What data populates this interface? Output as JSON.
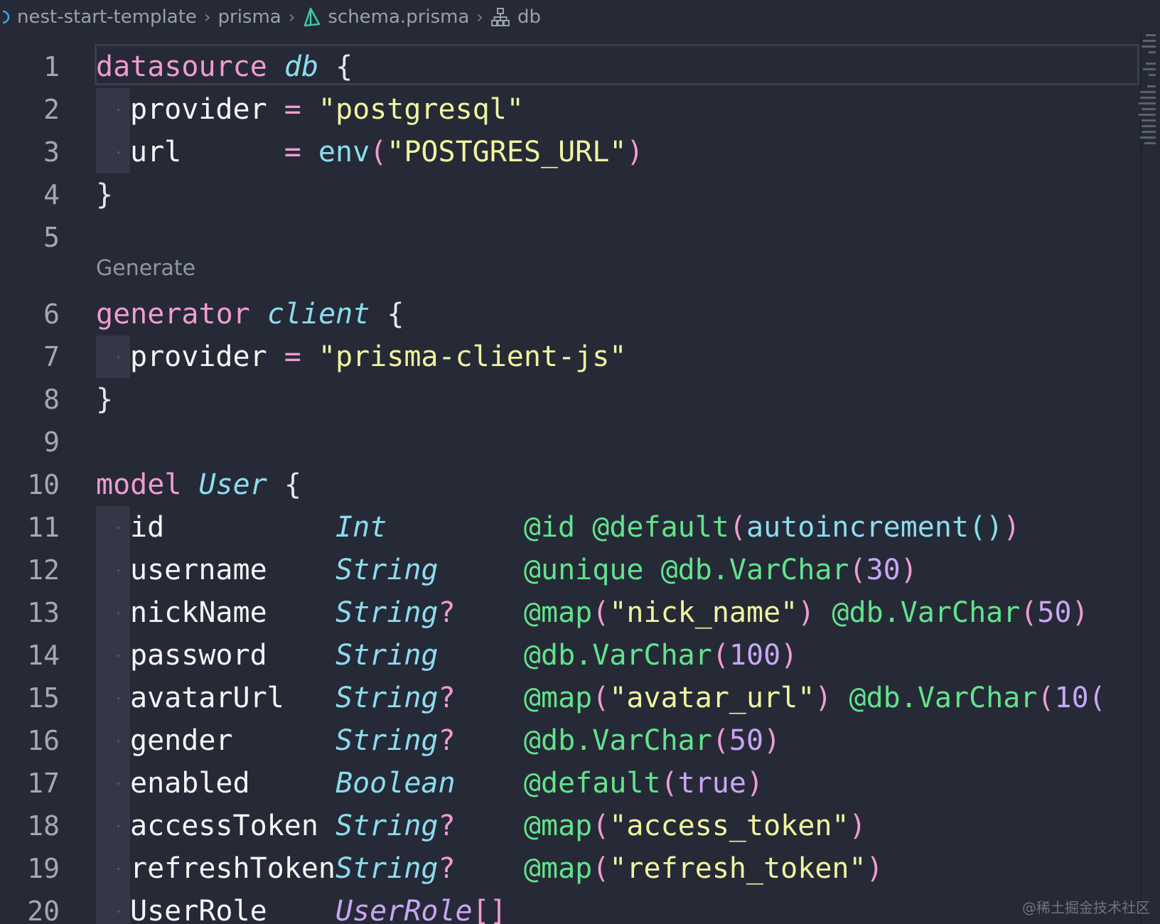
{
  "breadcrumb": {
    "items": [
      "nest-start-template",
      "prisma",
      "schema.prisma",
      "db"
    ],
    "separator": ">"
  },
  "codelens": "Generate",
  "lines": [
    {
      "n": "1",
      "tokens": [
        {
          "t": "datasource",
          "c": "kw"
        },
        {
          "t": " "
        },
        {
          "t": "db",
          "c": "name"
        },
        {
          "t": " {",
          "c": "punc"
        }
      ]
    },
    {
      "n": "2",
      "tokens": [
        {
          "t": "provider",
          "c": "field"
        },
        {
          "t": " = ",
          "c": "op"
        },
        {
          "t": "\"postgresql\"",
          "c": "str"
        }
      ]
    },
    {
      "n": "3",
      "tokens": [
        {
          "t": "url",
          "c": "field"
        },
        {
          "t": "      = ",
          "c": "op"
        },
        {
          "t": "env",
          "c": "fn"
        },
        {
          "t": "(",
          "c": "paren"
        },
        {
          "t": "\"POSTGRES_URL\"",
          "c": "str"
        },
        {
          "t": ")",
          "c": "paren"
        }
      ]
    },
    {
      "n": "4",
      "tokens": [
        {
          "t": "}",
          "c": "punc"
        }
      ]
    },
    {
      "n": "5",
      "tokens": []
    },
    {
      "n": "6",
      "tokens": [
        {
          "t": "generator",
          "c": "kw"
        },
        {
          "t": " "
        },
        {
          "t": "client",
          "c": "name"
        },
        {
          "t": " {",
          "c": "punc"
        }
      ]
    },
    {
      "n": "7",
      "tokens": [
        {
          "t": "provider",
          "c": "field"
        },
        {
          "t": " = ",
          "c": "op"
        },
        {
          "t": "\"prisma-client-js\"",
          "c": "str"
        }
      ]
    },
    {
      "n": "8",
      "tokens": [
        {
          "t": "}",
          "c": "punc"
        }
      ]
    },
    {
      "n": "9",
      "tokens": []
    },
    {
      "n": "10",
      "tokens": [
        {
          "t": "model",
          "c": "kw"
        },
        {
          "t": " "
        },
        {
          "t": "User",
          "c": "name"
        },
        {
          "t": " {",
          "c": "punc"
        }
      ]
    },
    {
      "n": "11",
      "tokens": [
        {
          "t": "id          ",
          "c": "field"
        },
        {
          "t": "Int",
          "c": "ty"
        },
        {
          "t": "        "
        },
        {
          "t": "@id",
          "c": "attr"
        },
        {
          "t": " "
        },
        {
          "t": "@default",
          "c": "attr"
        },
        {
          "t": "(",
          "c": "paren"
        },
        {
          "t": "autoincrement",
          "c": "fn"
        },
        {
          "t": "()",
          "c": "fn"
        },
        {
          "t": ")",
          "c": "paren"
        }
      ]
    },
    {
      "n": "12",
      "tokens": [
        {
          "t": "username    ",
          "c": "field"
        },
        {
          "t": "String",
          "c": "ty"
        },
        {
          "t": "     "
        },
        {
          "t": "@unique",
          "c": "attr"
        },
        {
          "t": " "
        },
        {
          "t": "@db.VarChar",
          "c": "attr"
        },
        {
          "t": "(",
          "c": "paren"
        },
        {
          "t": "30",
          "c": "num"
        },
        {
          "t": ")",
          "c": "paren"
        }
      ]
    },
    {
      "n": "13",
      "tokens": [
        {
          "t": "nickName    ",
          "c": "field"
        },
        {
          "t": "String",
          "c": "ty"
        },
        {
          "t": "?",
          "c": "qm"
        },
        {
          "t": "    "
        },
        {
          "t": "@map",
          "c": "attr"
        },
        {
          "t": "(",
          "c": "paren"
        },
        {
          "t": "\"nick_name\"",
          "c": "str"
        },
        {
          "t": ")",
          "c": "paren"
        },
        {
          "t": " "
        },
        {
          "t": "@db.VarChar",
          "c": "attr"
        },
        {
          "t": "(",
          "c": "paren"
        },
        {
          "t": "50",
          "c": "num"
        },
        {
          "t": ")",
          "c": "paren"
        }
      ]
    },
    {
      "n": "14",
      "tokens": [
        {
          "t": "password    ",
          "c": "field"
        },
        {
          "t": "String",
          "c": "ty"
        },
        {
          "t": "     "
        },
        {
          "t": "@db.VarChar",
          "c": "attr"
        },
        {
          "t": "(",
          "c": "paren"
        },
        {
          "t": "100",
          "c": "num"
        },
        {
          "t": ")",
          "c": "paren"
        }
      ]
    },
    {
      "n": "15",
      "tokens": [
        {
          "t": "avatarUrl   ",
          "c": "field"
        },
        {
          "t": "String",
          "c": "ty"
        },
        {
          "t": "?",
          "c": "qm"
        },
        {
          "t": "    "
        },
        {
          "t": "@map",
          "c": "attr"
        },
        {
          "t": "(",
          "c": "paren"
        },
        {
          "t": "\"avatar_url\"",
          "c": "str"
        },
        {
          "t": ")",
          "c": "paren"
        },
        {
          "t": " "
        },
        {
          "t": "@db.VarChar",
          "c": "attr"
        },
        {
          "t": "(",
          "c": "paren"
        },
        {
          "t": "10(",
          "c": "num"
        }
      ]
    },
    {
      "n": "16",
      "tokens": [
        {
          "t": "gender      ",
          "c": "field"
        },
        {
          "t": "String",
          "c": "ty"
        },
        {
          "t": "?",
          "c": "qm"
        },
        {
          "t": "    "
        },
        {
          "t": "@db.VarChar",
          "c": "attr"
        },
        {
          "t": "(",
          "c": "paren"
        },
        {
          "t": "50",
          "c": "num"
        },
        {
          "t": ")",
          "c": "paren"
        }
      ]
    },
    {
      "n": "17",
      "tokens": [
        {
          "t": "enabled     ",
          "c": "field"
        },
        {
          "t": "Boolean",
          "c": "ty"
        },
        {
          "t": "    "
        },
        {
          "t": "@default",
          "c": "attr"
        },
        {
          "t": "(",
          "c": "paren"
        },
        {
          "t": "true",
          "c": "num"
        },
        {
          "t": ")",
          "c": "paren"
        }
      ]
    },
    {
      "n": "18",
      "tokens": [
        {
          "t": "accessToken ",
          "c": "field"
        },
        {
          "t": "String",
          "c": "ty"
        },
        {
          "t": "?",
          "c": "qm"
        },
        {
          "t": "    "
        },
        {
          "t": "@map",
          "c": "attr"
        },
        {
          "t": "(",
          "c": "paren"
        },
        {
          "t": "\"access_token\"",
          "c": "str"
        },
        {
          "t": ")",
          "c": "paren"
        }
      ]
    },
    {
      "n": "19",
      "tokens": [
        {
          "t": "refreshToken",
          "c": "field"
        },
        {
          "t": "String",
          "c": "ty"
        },
        {
          "t": "?",
          "c": "qm"
        },
        {
          "t": "    "
        },
        {
          "t": "@map",
          "c": "attr"
        },
        {
          "t": "(",
          "c": "paren"
        },
        {
          "t": "\"refresh_token\"",
          "c": "str"
        },
        {
          "t": ")",
          "c": "paren"
        }
      ]
    },
    {
      "n": "20",
      "tokens": [
        {
          "t": "UserRole    ",
          "c": "field"
        },
        {
          "t": "UserRole",
          "c": "ty2"
        },
        {
          "t": "[]",
          "c": "op"
        }
      ]
    }
  ],
  "watermark": "@稀土掘金技术社区"
}
